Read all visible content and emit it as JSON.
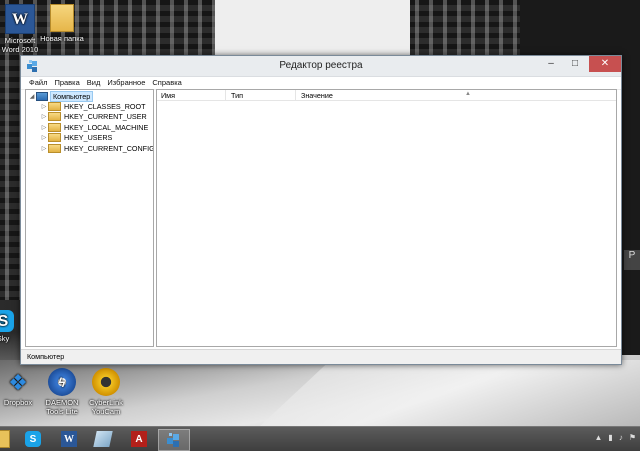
{
  "window": {
    "title": "Редактор реестра",
    "controls": {
      "minimize": "–",
      "maximize": "□",
      "close": "✕"
    }
  },
  "menu": [
    "Файл",
    "Правка",
    "Вид",
    "Избранное",
    "Справка"
  ],
  "tree": {
    "root": {
      "label": "Компьютер",
      "icon": "computer-icon",
      "expanded": true,
      "selected": true
    },
    "children": [
      {
        "label": "HKEY_CLASSES_ROOT",
        "icon": "folder-icon"
      },
      {
        "label": "HKEY_CURRENT_USER",
        "icon": "folder-icon"
      },
      {
        "label": "HKEY_LOCAL_MACHINE",
        "icon": "folder-icon"
      },
      {
        "label": "HKEY_USERS",
        "icon": "folder-icon"
      },
      {
        "label": "HKEY_CURRENT_CONFIG",
        "icon": "folder-icon"
      }
    ]
  },
  "values_pane": {
    "columns": [
      "Имя",
      "Тип",
      "Значение"
    ],
    "rows": []
  },
  "status_bar": "Компьютер",
  "desktop_icons": [
    {
      "label": "Microsoft Word 2010",
      "icon": "word-icon"
    },
    {
      "label": "Новая папка",
      "icon": "folder-icon"
    },
    {
      "label": "Dropbox",
      "icon": "dropbox-icon"
    },
    {
      "label": "DAEMON Tools Lite",
      "icon": "daemon-tools-icon"
    },
    {
      "label": "CyberLink YouCam",
      "icon": "cyberlink-youcam-icon"
    },
    {
      "label": "Sky",
      "icon": "skype-icon"
    }
  ],
  "taskbar": {
    "apps": [
      {
        "icon": "file-explorer-icon",
        "active": false
      },
      {
        "icon": "skype-icon",
        "active": false
      },
      {
        "icon": "word-icon",
        "active": false
      },
      {
        "icon": "app-icon",
        "active": false
      },
      {
        "icon": "acrobat-icon",
        "active": false
      },
      {
        "icon": "regedit-icon",
        "active": true
      }
    ]
  },
  "colors": {
    "close_button": "#c75050",
    "selection": "#cde8ff",
    "taskbar": "#4a4a4a"
  }
}
